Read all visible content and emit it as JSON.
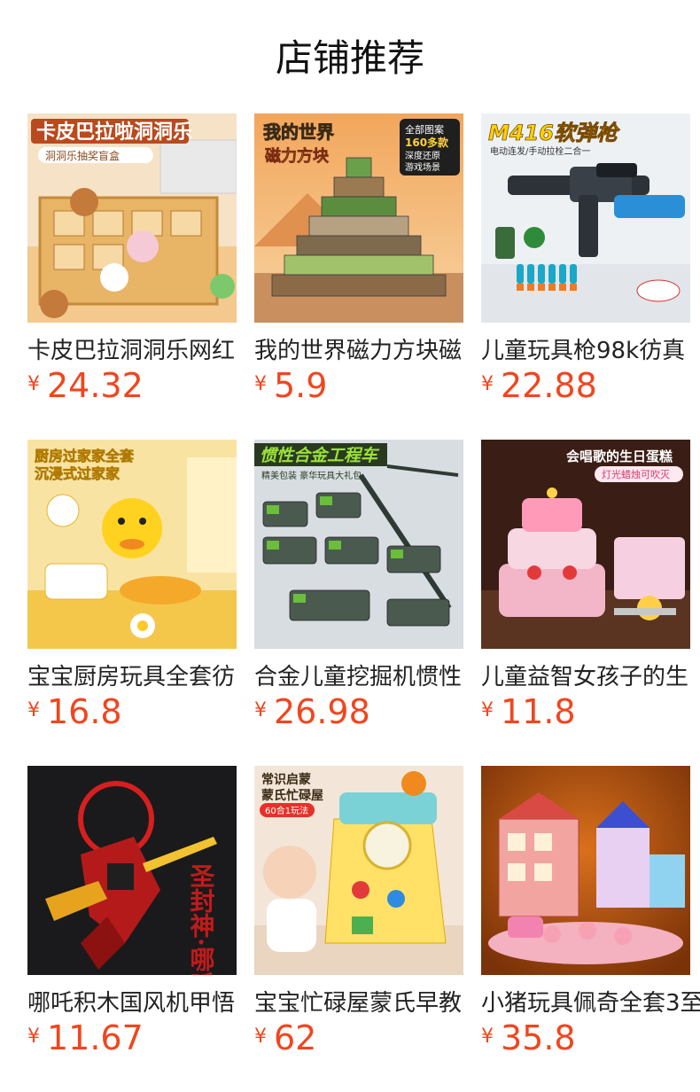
{
  "section": {
    "title": "店铺推荐"
  },
  "currency_symbol": "¥",
  "products": [
    {
      "name": "卡皮巴拉洞洞乐网红",
      "price": "24.32",
      "image": {
        "subject": "capybara-blind-box-game",
        "banner": "卡皮巴拉啦洞洞乐",
        "sub_banner": "洞洞乐抽奖盲盒"
      }
    },
    {
      "name": "我的世界磁力方块磁",
      "price": "5.9",
      "image": {
        "subject": "magnetic-block-pyramid",
        "banner": "我的世界",
        "sub_banner": "磁力方块",
        "tag_lines": [
          "全部图案",
          "160多款",
          "深度还原",
          "游戏场景"
        ]
      }
    },
    {
      "name": "儿童玩具枪98k彷真",
      "price": "22.88",
      "image": {
        "subject": "toy-soft-bullet-gun",
        "banner": "M416软弹枪",
        "sub_banner": "电动连发/手动拉栓二合一"
      }
    },
    {
      "name": "宝宝厨房玩具全套彷",
      "price": "16.8",
      "image": {
        "subject": "kids-kitchen-play-set",
        "banner": "厨房过家家全套",
        "sub_banner": "沉浸式过家家"
      }
    },
    {
      "name": "合金儿童挖掘机惯性",
      "price": "26.98",
      "image": {
        "subject": "alloy-construction-vehicles",
        "banner": "惯性合金工程车",
        "sub_banner": "精美包装 豪华玩具大礼包"
      }
    },
    {
      "name": "儿童益智女孩子的生",
      "price": "11.8",
      "image": {
        "subject": "singing-birthday-cake-toy",
        "banner": "会唱歌的生日蛋糕",
        "sub_banner": "灯光蜡烛可吹灭"
      }
    },
    {
      "name": "哪吒积木国风机甲悟",
      "price": "11.67",
      "image": {
        "subject": "nezha-mecha-building-blocks",
        "banner": "圣封神·哪吒"
      }
    },
    {
      "name": "宝宝忙碌屋蒙氏早教",
      "price": "62",
      "image": {
        "subject": "montessori-busy-house",
        "banner": "常识启蒙",
        "sub_banner": "蒙氏忙碌屋",
        "badge": "60合1玩法"
      }
    },
    {
      "name": "小猪玩具佩奇全套3至",
      "price": "35.8",
      "image": {
        "subject": "peppa-pig-dollhouse-set"
      }
    }
  ],
  "colors": {
    "price": "#f0461f",
    "title_text": "#111111",
    "name_text": "#222222"
  }
}
